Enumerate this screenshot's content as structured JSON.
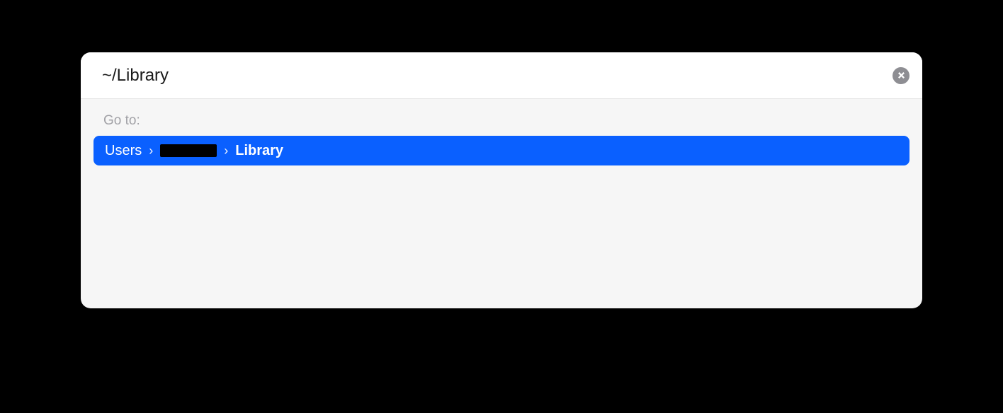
{
  "input": {
    "value": "~/Library"
  },
  "results": {
    "label": "Go to:",
    "breadcrumb": {
      "segments": [
        {
          "text": "Users",
          "bold": false,
          "redacted": false
        },
        {
          "text": "",
          "bold": false,
          "redacted": true
        },
        {
          "text": "Library",
          "bold": true,
          "redacted": false
        }
      ],
      "separator": "›"
    }
  },
  "colors": {
    "selection": "#0a60ff",
    "background": "#000000",
    "panel": "#f6f6f6",
    "inputBg": "#ffffff"
  }
}
